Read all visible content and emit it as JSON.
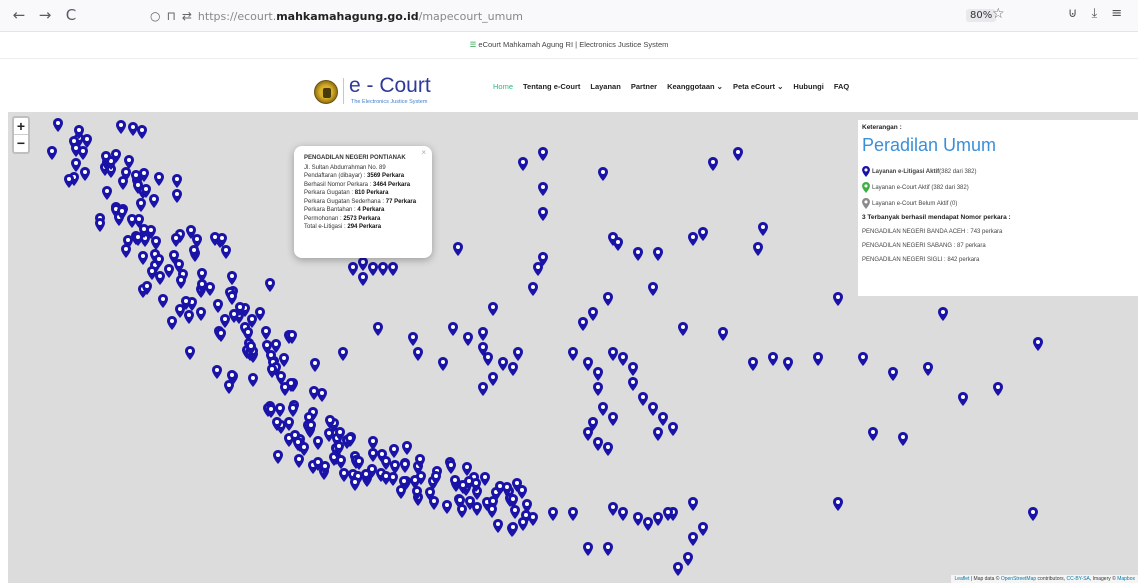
{
  "browser": {
    "back": "←",
    "forward": "→",
    "reload": "C",
    "url_prefix": "https://ecourt.",
    "url_domain": "mahkamahagung.go.id",
    "url_path": "/mapecourt_umum",
    "zoom": "80%"
  },
  "top_strip": {
    "site_name": "eCourt Mahkamah Agung RI",
    "separator": "|",
    "tagline": "Electronics Justice System"
  },
  "header": {
    "logo_title": "e - Court",
    "logo_subtitle": "The Electronics Justice System",
    "nav": [
      {
        "label": "Home"
      },
      {
        "label": "Tentang e-Court"
      },
      {
        "label": "Layanan"
      },
      {
        "label": "Partner"
      },
      {
        "label": "Keanggotaan ⌄"
      },
      {
        "label": "Peta eCourt ⌄"
      },
      {
        "label": "Hubungi"
      },
      {
        "label": "FAQ"
      }
    ]
  },
  "map": {
    "zoom_in": "+",
    "zoom_out": "−",
    "marker_color": "#1a13a8",
    "attribution_leaflet": "Leaflet",
    "attribution_text": " | Map data © ",
    "attribution_osm": "OpenStreetMap",
    "attribution_contrib": " contributors, ",
    "attribution_license": "CC-BY-SA",
    "attribution_imagery": ", Imagery © ",
    "attribution_mapbox": "Mapbox"
  },
  "popup": {
    "title": "PENGADILAN NEGERI PONTIANAK",
    "address": "Jl. Sultan Abdurrahman No. 89",
    "rows": [
      {
        "label": "Pendaftaran (dibayar) : ",
        "value": "3569 Perkara"
      },
      {
        "label": "Berhasil Nomor Perkara : ",
        "value": "3464 Perkara"
      },
      {
        "label": "Perkara Gugatan : ",
        "value": "810 Perkara"
      },
      {
        "label": "Perkara Gugatan Sederhana : ",
        "value": "77 Perkara"
      },
      {
        "label": "Perkara Bantahan : ",
        "value": "4 Perkara"
      },
      {
        "label": "Permohonan : ",
        "value": "2573 Perkara"
      },
      {
        "label": "Total e-Litigasi : ",
        "value": "294 Perkara"
      }
    ],
    "close": "×"
  },
  "legend": {
    "label": "Keterangan :",
    "heading": "Peradilan Umum",
    "items": [
      {
        "bold": "Layanan e-Litigasi Aktif",
        "text": " (382 dari 382)",
        "color": "#1a13a8"
      },
      {
        "bold": "",
        "text": "Layanan e-Court Aktif (382 dari 382)",
        "color": "#3cb043"
      },
      {
        "bold": "",
        "text": "Layanan e-Court Belum Aktif (0)",
        "color": "#8a8a8a"
      }
    ],
    "top_title": "3 Terbanyak berhasil mendapat Nomor perkara :",
    "top": [
      "PENGADILAN NEGERI BANDA ACEH : 743 perkara",
      "PENGADILAN NEGERI SABANG : 87 perkara",
      "PENGADILAN NEGERI SIGLI : 842 perkara"
    ]
  }
}
